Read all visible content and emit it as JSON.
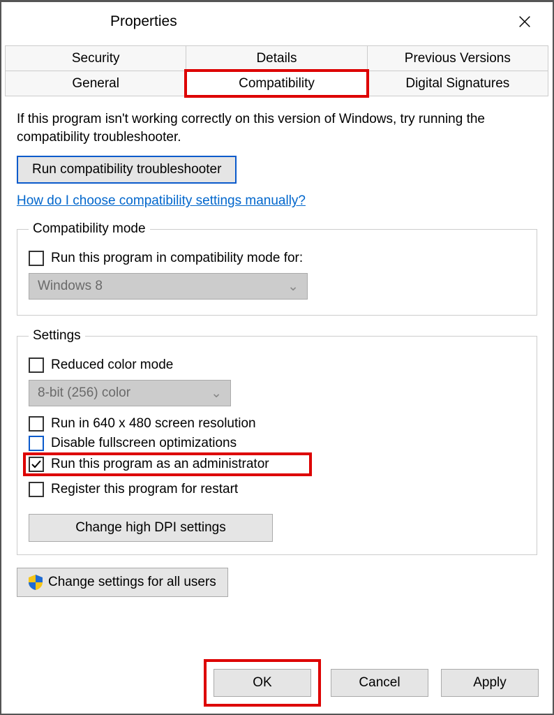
{
  "window": {
    "title": "Properties"
  },
  "tabs": {
    "row1": [
      "Security",
      "Details",
      "Previous Versions"
    ],
    "row2": [
      "General",
      "Compatibility",
      "Digital Signatures"
    ],
    "active": "Compatibility"
  },
  "intro": "If this program isn't working correctly on this version of Windows, try running the compatibility troubleshooter.",
  "troubleshoot_btn": "Run compatibility troubleshooter",
  "help_link": "How do I choose compatibility settings manually?",
  "compat_mode": {
    "legend": "Compatibility mode",
    "checkbox": "Run this program in compatibility mode for:",
    "dropdown": "Windows 8"
  },
  "settings": {
    "legend": "Settings",
    "reduced_color": "Reduced color mode",
    "color_dropdown": "8-bit (256) color",
    "run_640": "Run in 640 x 480 screen resolution",
    "disable_fullscreen": "Disable fullscreen optimizations",
    "run_admin": "Run this program as an administrator",
    "register_restart": "Register this program for restart",
    "dpi_btn": "Change high DPI settings"
  },
  "all_users_btn": "Change settings for all users",
  "buttons": {
    "ok": "OK",
    "cancel": "Cancel",
    "apply": "Apply"
  }
}
